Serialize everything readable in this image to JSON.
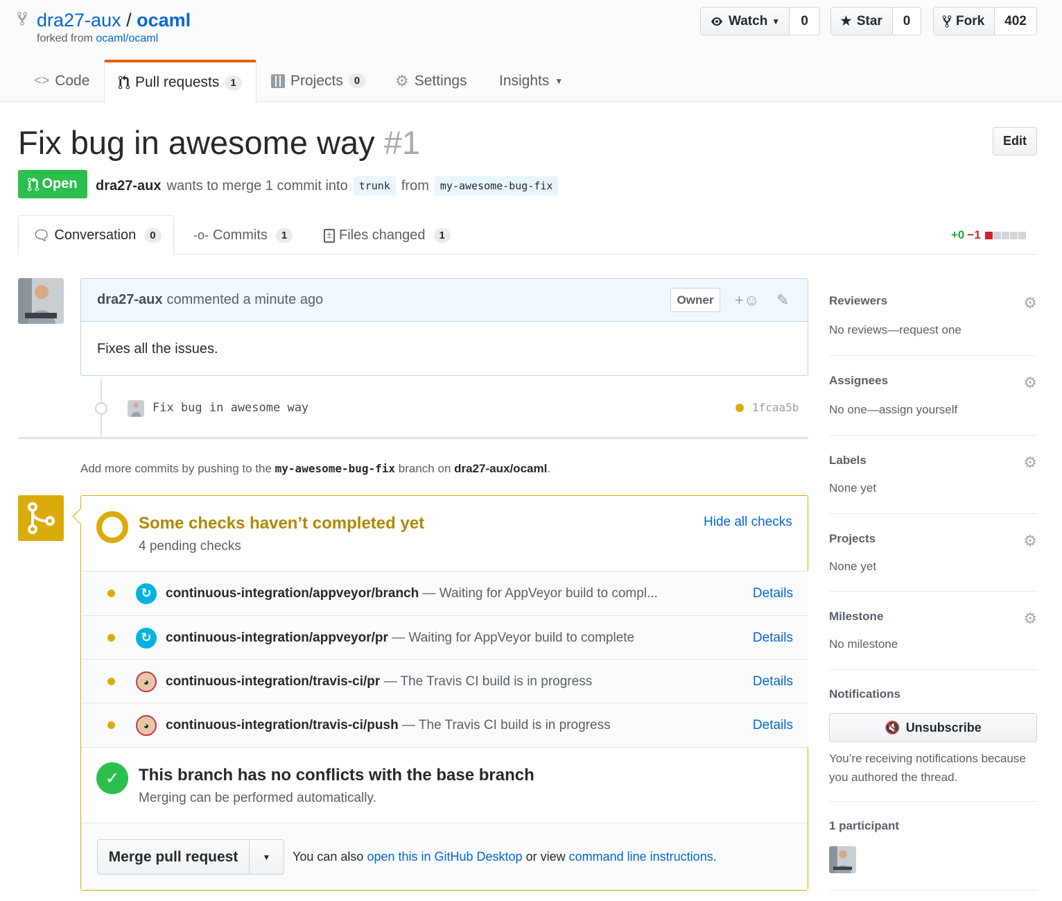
{
  "repo": {
    "owner": "dra27-aux",
    "sep": "/",
    "name": "ocaml",
    "forked_prefix": "forked from",
    "forked_from": "ocaml/ocaml"
  },
  "actions": {
    "watch": {
      "label": "Watch",
      "count": "0"
    },
    "star": {
      "label": "Star",
      "count": "0"
    },
    "fork": {
      "label": "Fork",
      "count": "402"
    }
  },
  "nav": {
    "code": "Code",
    "pulls": "Pull requests",
    "pulls_count": "1",
    "projects": "Projects",
    "projects_count": "0",
    "settings": "Settings",
    "insights": "Insights"
  },
  "pr": {
    "title": "Fix bug in awesome way",
    "number": "#1",
    "edit": "Edit",
    "state": "Open",
    "author": "dra27-aux",
    "merge_text": "wants to merge 1 commit into",
    "base": "trunk",
    "from": "from",
    "head": "my-awesome-bug-fix"
  },
  "subtabs": {
    "conversation": "Conversation",
    "conversation_count": "0",
    "commits": "Commits",
    "commits_count": "1",
    "files": "Files changed",
    "files_count": "1"
  },
  "diffstat": {
    "add": "+0",
    "del": "−1"
  },
  "comment": {
    "author": "dra27-aux",
    "action": "commented a minute ago",
    "badge": "Owner",
    "body": "Fixes all the issues."
  },
  "commit": {
    "message": "Fix bug in awesome way",
    "sha": "1fcaa5b"
  },
  "hint": {
    "pre": "Add more commits by pushing to the",
    "branch": "my-awesome-bug-fix",
    "mid": "branch on",
    "repo": "dra27-aux/ocaml",
    "end": "."
  },
  "checks": {
    "title": "Some checks haven’t completed yet",
    "subtitle": "4 pending checks",
    "toggle": "Hide all checks",
    "items": [
      {
        "name": "continuous-integration/appveyor/branch",
        "desc": "— Waiting for AppVeyor build to compl...",
        "link": "Details"
      },
      {
        "name": "continuous-integration/appveyor/pr",
        "desc": "— Waiting for AppVeyor build to complete",
        "link": "Details"
      },
      {
        "name": "continuous-integration/travis-ci/pr",
        "desc": "— The Travis CI build is in progress",
        "link": "Details"
      },
      {
        "name": "continuous-integration/travis-ci/push",
        "desc": "— The Travis CI build is in progress",
        "link": "Details"
      }
    ]
  },
  "merge": {
    "title": "This branch has no conflicts with the base branch",
    "subtitle": "Merging can be performed automatically.",
    "button": "Merge pull request",
    "also": "You can also",
    "desktop": "open this in GitHub Desktop",
    "or": "or view",
    "cli": "command line instructions",
    "end": "."
  },
  "sidebar": {
    "reviewers": "Reviewers",
    "reviewers_v": "No reviews—request one",
    "assignees": "Assignees",
    "assignees_v": "No one—assign yourself",
    "labels": "Labels",
    "labels_v": "None yet",
    "projects": "Projects",
    "projects_v": "None yet",
    "milestone": "Milestone",
    "milestone_v": "No milestone",
    "notifications": "Notifications",
    "unsubscribe": "Unsubscribe",
    "notif_reason": "You’re receiving notifications because you authored the thread.",
    "participants": "1 participant"
  }
}
